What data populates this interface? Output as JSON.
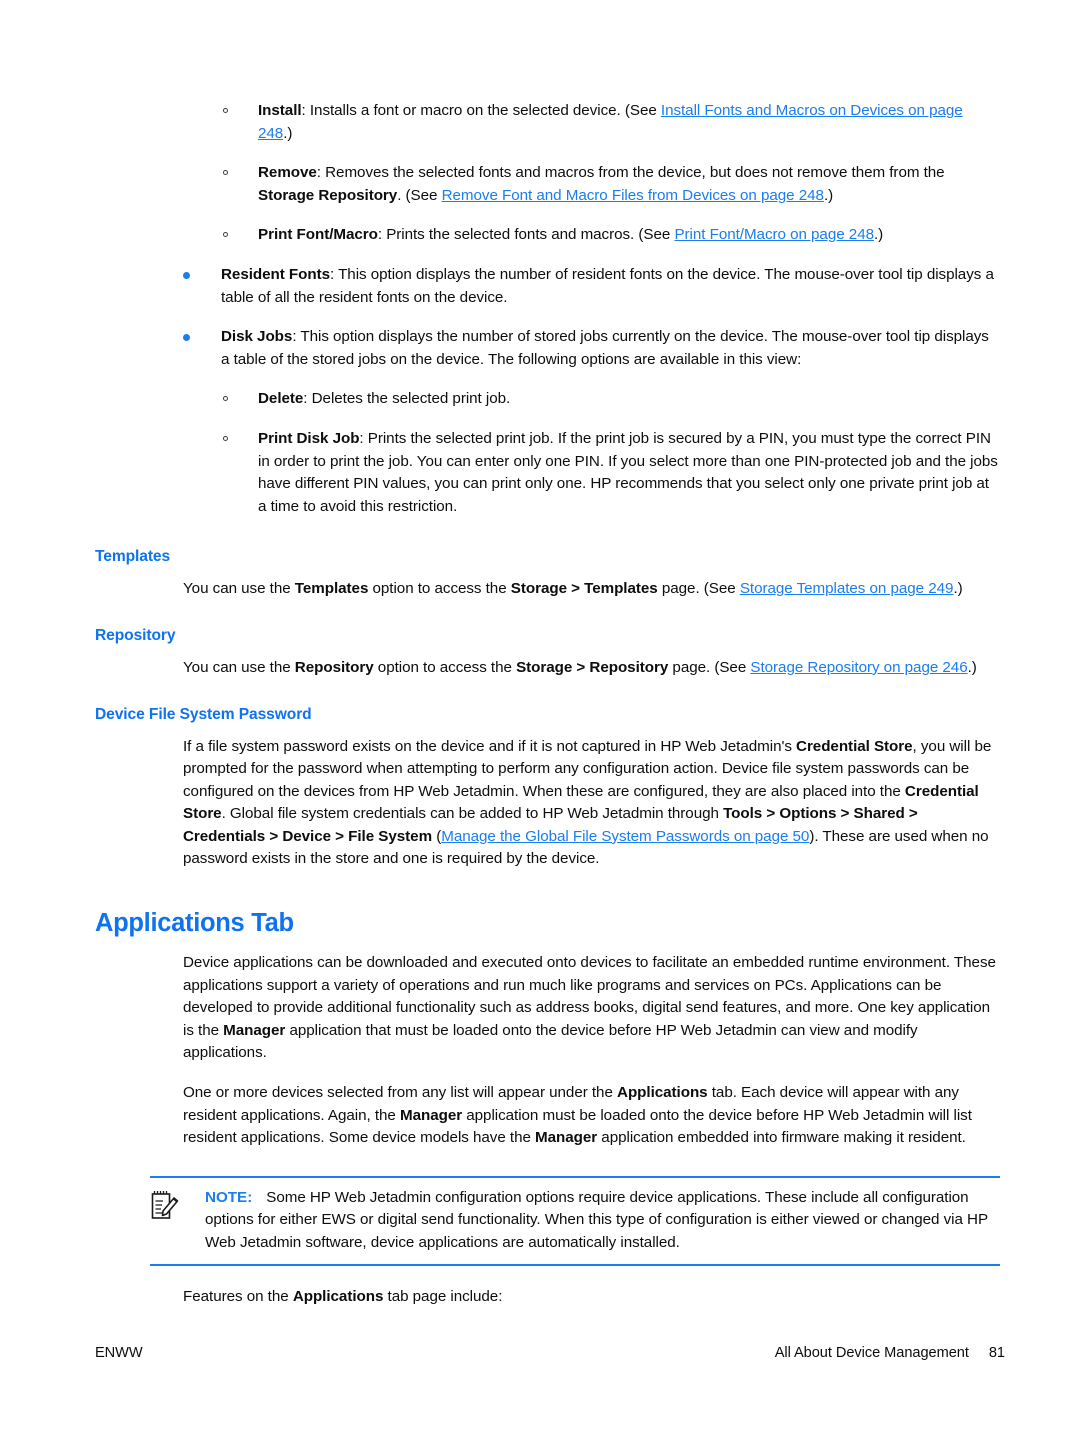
{
  "page": {
    "body_font_color": "#0d0d0d",
    "accent_blue": "#1a7df0",
    "heading_blue": "#0f72ef"
  },
  "lists": {
    "font_macro_actions": [
      {
        "term": "Install",
        "text_before": ": Installs a font or macro on the selected device. (See ",
        "link": "Install Fonts and Macros on Devices on page 248",
        "text_after": ".)"
      },
      {
        "term": "Remove",
        "text_before": ": Removes the selected fonts and macros from the device, but does not remove them from the ",
        "term2": "Storage Repository",
        "text_mid": ". (See ",
        "link": "Remove Font and Macro Files from Devices on page 248",
        "text_after": ".)"
      },
      {
        "term": "Print Font/Macro",
        "text_before": ": Prints the selected fonts and macros. (See ",
        "link": "Print Font/Macro on page 248",
        "text_after": ".)"
      }
    ],
    "device_options": [
      {
        "term": "Resident Fonts",
        "text": ": This option displays the number of resident fonts on the device. The mouse-over tool tip displays a table of all the resident fonts on the device."
      },
      {
        "term": "Disk Jobs",
        "text": ": This option displays the number of stored jobs currently on the device. The mouse-over tool tip displays a table of the stored jobs on the device. The following options are available in this view:"
      }
    ],
    "disk_job_actions": [
      {
        "term": "Delete",
        "text": ": Deletes the selected print job."
      },
      {
        "term": "Print Disk Job",
        "text": ": Prints the selected print job. If the print job is secured by a PIN, you must type the correct PIN in order to print the job. You can enter only one PIN. If you select more than one PIN-protected job and the jobs have different PIN values, you can print only one. HP recommends that you select only one private print job at a time to avoid this restriction."
      }
    ]
  },
  "sections": {
    "templates": {
      "heading": "Templates",
      "p1_a": "You can use the ",
      "p1_b": "Templates",
      "p1_c": " option to access the ",
      "p1_d": "Storage > Templates",
      "p1_e": " page. (See ",
      "p1_link": "Storage Templates on page 249",
      "p1_f": ".)"
    },
    "repository": {
      "heading": "Repository",
      "p1_a": "You can use the ",
      "p1_b": "Repository",
      "p1_c": " option to access the ",
      "p1_d": "Storage > Repository",
      "p1_e": " page. (See ",
      "p1_link": "Storage Repository on page 246",
      "p1_f": ".)"
    },
    "device_file_system_password": {
      "heading": "Device File System Password",
      "p1_a": "If a file system password exists on the device and if it is not captured in HP Web Jetadmin's ",
      "p1_b": "Credential Store",
      "p1_c": ", you will be prompted for the password when attempting to perform any configuration action. Device file system passwords can be configured on the devices from HP Web Jetadmin. When these are configured, they are also placed into the ",
      "p1_d": "Credential Store",
      "p1_e": ". Global file system credentials can be added to HP Web Jetadmin through ",
      "p1_f": "Tools > Options > Shared > Credentials > Device > File System",
      "p1_g": " (",
      "p1_link": "Manage the Global File System Passwords on page 50",
      "p1_h": "). These are used when no password exists in the store and one is required by the device."
    },
    "applications_tab": {
      "heading": "Applications Tab",
      "p1_a": "Device applications can be downloaded and executed onto devices to facilitate an embedded runtime environment. These applications support a variety of operations and run much like programs and services on PCs. Applications can be developed to provide additional functionality such as address books, digital send features, and more. One key application is the ",
      "p1_b": "Manager",
      "p1_c": " application that must be loaded onto the device before HP Web Jetadmin can view and modify applications.",
      "p2_a": "One or more devices selected from any list will appear under the ",
      "p2_b": "Applications",
      "p2_c": " tab. Each device will appear with any resident applications. Again, the ",
      "p2_d": "Manager",
      "p2_e": " application must be loaded onto the device before HP Web Jetadmin will list resident applications. Some device models have the ",
      "p2_f": "Manager",
      "p2_g": " application embedded into firmware making it resident.",
      "p3_a": "Features on the ",
      "p3_b": "Applications",
      "p3_c": " tab page include:"
    }
  },
  "note": {
    "icon": "note-pad-pencil-icon",
    "label": "NOTE:",
    "text": "Some HP Web Jetadmin configuration options require device applications. These include all configuration options for either EWS or digital send functionality. When this type of configuration is either viewed or changed via HP Web Jetadmin software, device applications are automatically installed."
  },
  "footer": {
    "left": "ENWW",
    "right": "All About Device Management",
    "page_number": "81"
  }
}
